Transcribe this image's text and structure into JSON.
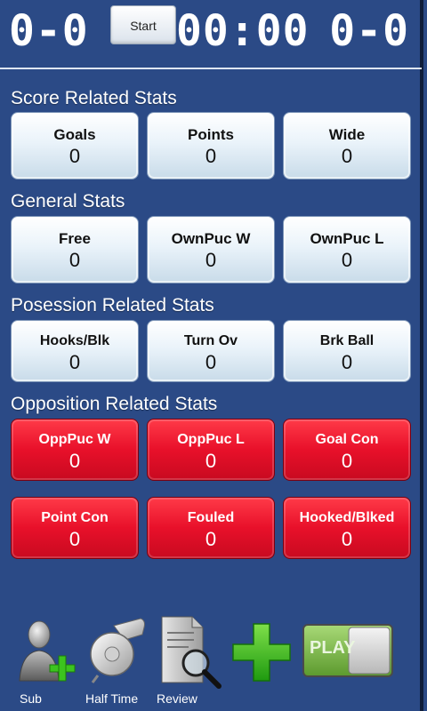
{
  "scoreboard": {
    "home_score": "0-0",
    "start_label": "Start",
    "clock": "00:00",
    "away_score": "0-0"
  },
  "sections": [
    {
      "title": "Score Related Stats",
      "buttons": [
        {
          "label": "Goals",
          "value": "0"
        },
        {
          "label": "Points",
          "value": "0"
        },
        {
          "label": "Wide",
          "value": "0"
        }
      ]
    },
    {
      "title": "General Stats",
      "buttons": [
        {
          "label": "Free",
          "value": "0"
        },
        {
          "label": "OwnPuc W",
          "value": "0"
        },
        {
          "label": "OwnPuc L",
          "value": "0"
        }
      ]
    },
    {
      "title": "Posession Related Stats",
      "buttons": [
        {
          "label": "Hooks/Blk",
          "value": "0"
        },
        {
          "label": "Turn Ov",
          "value": "0"
        },
        {
          "label": "Brk Ball",
          "value": "0"
        }
      ]
    },
    {
      "title": "Opposition Related Stats",
      "buttons": [
        {
          "label": "OppPuc W",
          "value": "0"
        },
        {
          "label": "OppPuc L",
          "value": "0"
        },
        {
          "label": "Goal Con",
          "value": "0"
        }
      ],
      "buttons2": [
        {
          "label": "Point Con",
          "value": "0"
        },
        {
          "label": "Fouled",
          "value": "0"
        },
        {
          "label": "Hooked/Blked",
          "value": "0"
        }
      ]
    }
  ],
  "toolbar": {
    "sub_label": "Sub",
    "half_time_label": "Half Time",
    "review_label": "Review",
    "play_label": "PLAY"
  },
  "colors": {
    "background": "#2b4a86",
    "opposition_button": "#e8102a",
    "add_icon": "#39c41f",
    "play_toggle": "#7bc043"
  },
  "icons": [
    "sub-person-add-icon",
    "whistle-icon",
    "review-document-magnifier-icon",
    "plus-icon",
    "play-toggle-switch"
  ]
}
